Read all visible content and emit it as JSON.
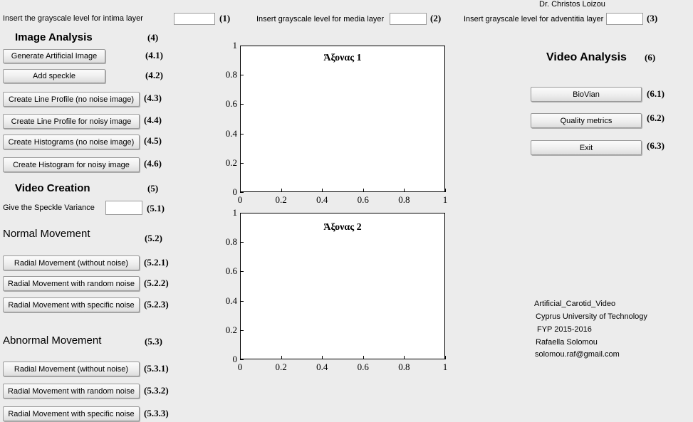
{
  "window": {
    "title": "Artificial_Carotid_Video",
    "background_color": "#ececec"
  },
  "inputs": [
    {
      "label": "Insert the grayscale level for intima layer",
      "value": "",
      "placeholder": "",
      "ref": "(1)"
    },
    {
      "label": "Insert grayscale level for media layer",
      "value": "",
      "placeholder": "",
      "ref": "(2)"
    },
    {
      "label": "Insert grayscale level for adventitia layer",
      "value": "",
      "placeholder": "",
      "ref": "(3)"
    }
  ],
  "image_analysis": {
    "title": "Image Analysis",
    "ref": "(4)",
    "buttons": [
      {
        "label": "Generate Artificial Image",
        "ref": "(4.1)"
      },
      {
        "label": "Add speckle",
        "ref": "(4.2)"
      },
      {
        "label": "Create Line Profile (no noise image)",
        "ref": "(4.3)"
      },
      {
        "label": "Create Line Profile for noisy image",
        "ref": "(4.4)"
      },
      {
        "label": "Create Histograms (no noise image)",
        "ref": "(4.5)"
      },
      {
        "label": "Create Histogram for noisy image",
        "ref": "(4.6)"
      }
    ]
  },
  "video_creation": {
    "title": "Video Creation",
    "ref": "(5)",
    "speckle_variance": {
      "label": "Give the Speckle Variance",
      "value": "",
      "placeholder": "",
      "ref": "(5.1)"
    },
    "normal_movement": {
      "title": "Normal Movement",
      "ref": "(5.2)",
      "buttons": [
        {
          "label": "Radial Movement (without noise)",
          "ref": "(5.2.1)"
        },
        {
          "label": "Radial Movement with random noise",
          "ref": "(5.2.2)"
        },
        {
          "label": "Radial Movement  with specific noise",
          "ref": "(5.2.3)"
        }
      ]
    },
    "abnormal_movement": {
      "title": "Abnormal Movement",
      "ref": "(5.3)",
      "buttons": [
        {
          "label": "Radial Movement (without noise)",
          "ref": "(5.3.1)"
        },
        {
          "label": "Radial Movement with random noise",
          "ref": "(5.3.2)"
        },
        {
          "label": "Radial Movement with specific noise",
          "ref": "(5.3.3)"
        }
      ]
    }
  },
  "video_analysis": {
    "title": "Video Analysis",
    "ref": "(6)",
    "buttons": [
      {
        "label": "BioVian",
        "ref": "(6.1)"
      },
      {
        "label": "Quality metrics",
        "ref": "(6.2)"
      },
      {
        "label": "Exit",
        "ref": "(6.3)"
      }
    ]
  },
  "credits": [
    "Artificial_Carotid_Video",
    "Cyprus University of Technology",
    "FYP 2015-2016",
    "Rafaella Solomou",
    "solomou.raf@gmail.com",
    "Dr. Christos Loizou"
  ],
  "chart_data": [
    {
      "type": "line",
      "title": "Άξονας 1",
      "xlabel": "",
      "ylabel": "",
      "xlim": [
        0,
        1
      ],
      "ylim": [
        0,
        1
      ],
      "xticks": [
        "0",
        "0.2",
        "0.4",
        "0.6",
        "0.8",
        "1"
      ],
      "yticks": [
        "0",
        "0.2",
        "0.4",
        "0.6",
        "0.8",
        "1"
      ],
      "xtick_values": [
        0,
        0.2,
        0.4,
        0.6,
        0.8,
        1
      ],
      "ytick_values": [
        0,
        0.2,
        0.4,
        0.6,
        0.8,
        1
      ],
      "grid": false,
      "legend": null,
      "series": [],
      "note": "empty axes - no data plotted"
    },
    {
      "type": "line",
      "title": "Άξονας 2",
      "xlabel": "",
      "ylabel": "",
      "xlim": [
        0,
        1
      ],
      "ylim": [
        0,
        1
      ],
      "xticks": [
        "0",
        "0.2",
        "0.4",
        "0.6",
        "0.8",
        "1"
      ],
      "yticks": [
        "0",
        "0.2",
        "0.4",
        "0.6",
        "0.8",
        "1"
      ],
      "xtick_values": [
        0,
        0.2,
        0.4,
        0.6,
        0.8,
        1
      ],
      "ytick_values": [
        0,
        0.2,
        0.4,
        0.6,
        0.8,
        1
      ],
      "grid": false,
      "legend": null,
      "series": [],
      "note": "empty axes - no data plotted"
    }
  ]
}
